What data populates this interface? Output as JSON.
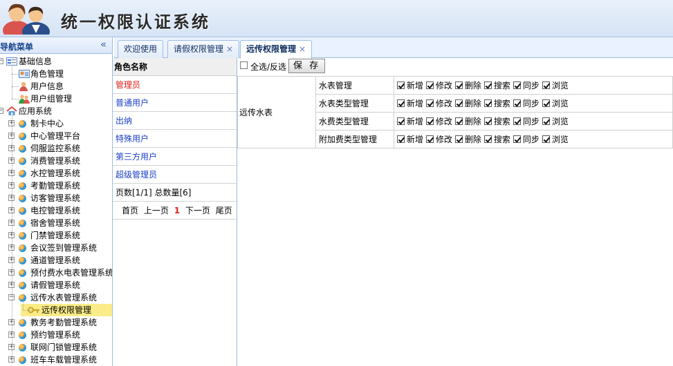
{
  "app": {
    "title": "统一权限认证系统"
  },
  "nav": {
    "title": "导航菜单",
    "collapse_icon": "double-chevron-left-icon",
    "tree": [
      {
        "label": "基础信息",
        "level": 0,
        "expanded": true,
        "icon": "folder-list-icon"
      },
      {
        "label": "角色管理",
        "level": 1,
        "icon": "id-card-icon"
      },
      {
        "label": "用户信息",
        "level": 1,
        "icon": "user-icon"
      },
      {
        "label": "用户组管理",
        "level": 1,
        "icon": "user-group-icon"
      },
      {
        "label": "应用系统",
        "level": 0,
        "expanded": true,
        "icon": "home-icon"
      },
      {
        "label": "制卡中心",
        "level": 1,
        "expanded": false,
        "icon": "module-ball-icon"
      },
      {
        "label": "中心管理平台",
        "level": 1,
        "expanded": false,
        "icon": "module-ball-icon"
      },
      {
        "label": "伺服监控系统",
        "level": 1,
        "expanded": false,
        "icon": "module-ball-icon"
      },
      {
        "label": "消费管理系统",
        "level": 1,
        "expanded": false,
        "icon": "module-ball-icon"
      },
      {
        "label": "水控管理系统",
        "level": 1,
        "expanded": false,
        "icon": "module-ball-icon"
      },
      {
        "label": "考勤管理系统",
        "level": 1,
        "expanded": false,
        "icon": "module-ball-icon"
      },
      {
        "label": "访客管理系统",
        "level": 1,
        "expanded": false,
        "icon": "module-ball-icon"
      },
      {
        "label": "电控管理系统",
        "level": 1,
        "expanded": false,
        "icon": "module-ball-icon"
      },
      {
        "label": "宿舍管理系统",
        "level": 1,
        "expanded": false,
        "icon": "module-ball-icon"
      },
      {
        "label": "门禁管理系统",
        "level": 1,
        "expanded": false,
        "icon": "module-ball-icon"
      },
      {
        "label": "会议签到管理系统",
        "level": 1,
        "expanded": false,
        "icon": "module-ball-icon"
      },
      {
        "label": "通道管理系统",
        "level": 1,
        "expanded": false,
        "icon": "module-ball-icon"
      },
      {
        "label": "预付费水电表管理系统",
        "level": 1,
        "expanded": false,
        "icon": "module-ball-icon"
      },
      {
        "label": "请假管理系统",
        "level": 1,
        "expanded": false,
        "icon": "module-ball-icon"
      },
      {
        "label": "远传水表管理系统",
        "level": 1,
        "expanded": true,
        "icon": "module-ball-icon"
      },
      {
        "label": "远传权限管理",
        "level": 2,
        "selected": true,
        "icon": "key-icon"
      },
      {
        "label": "教务考勤管理系统",
        "level": 1,
        "expanded": false,
        "icon": "module-ball-icon"
      },
      {
        "label": "预约管理系统",
        "level": 1,
        "expanded": false,
        "icon": "module-ball-icon"
      },
      {
        "label": "联网门锁管理系统",
        "level": 1,
        "expanded": false,
        "icon": "module-ball-icon"
      },
      {
        "label": "班车车载管理系统",
        "level": 1,
        "expanded": false,
        "icon": "module-ball-icon"
      }
    ]
  },
  "tabs": [
    {
      "label": "欢迎使用",
      "closable": false,
      "active": false
    },
    {
      "label": "请假权限管理",
      "closable": true,
      "active": false
    },
    {
      "label": "远传权限管理",
      "closable": true,
      "active": true
    }
  ],
  "roles": {
    "header": "角色名称",
    "items": [
      {
        "label": "管理员",
        "active": true
      },
      {
        "label": "普通用户"
      },
      {
        "label": "出纳"
      },
      {
        "label": "特殊用户"
      },
      {
        "label": "第三方用户"
      },
      {
        "label": "超级管理员"
      }
    ],
    "pager_info": "页数[1/1]  总数量[6]",
    "pager": {
      "first": "首页",
      "prev": "上一页",
      "current": "1",
      "next": "下一页",
      "last": "尾页"
    }
  },
  "permissions": {
    "select_all_label": "全选/反选",
    "select_all_checked": false,
    "save_label": "保 存",
    "group": "远传水表",
    "operations": [
      "新增",
      "修改",
      "删除",
      "搜索",
      "同步",
      "浏览"
    ],
    "modules": [
      {
        "name": "水表管理",
        "checked": [
          true,
          true,
          true,
          true,
          true,
          true
        ]
      },
      {
        "name": "水表类型管理",
        "checked": [
          true,
          true,
          true,
          true,
          true,
          true
        ]
      },
      {
        "name": "水费类型管理",
        "checked": [
          true,
          true,
          true,
          true,
          true,
          true
        ]
      },
      {
        "name": "附加费类型管理",
        "checked": [
          true,
          true,
          true,
          true,
          true,
          true
        ]
      }
    ]
  },
  "colors": {
    "accent": "#99bbe8",
    "selected_row": "#fbec88",
    "active_role": "#e0201a",
    "link": "#1a3fc7"
  }
}
